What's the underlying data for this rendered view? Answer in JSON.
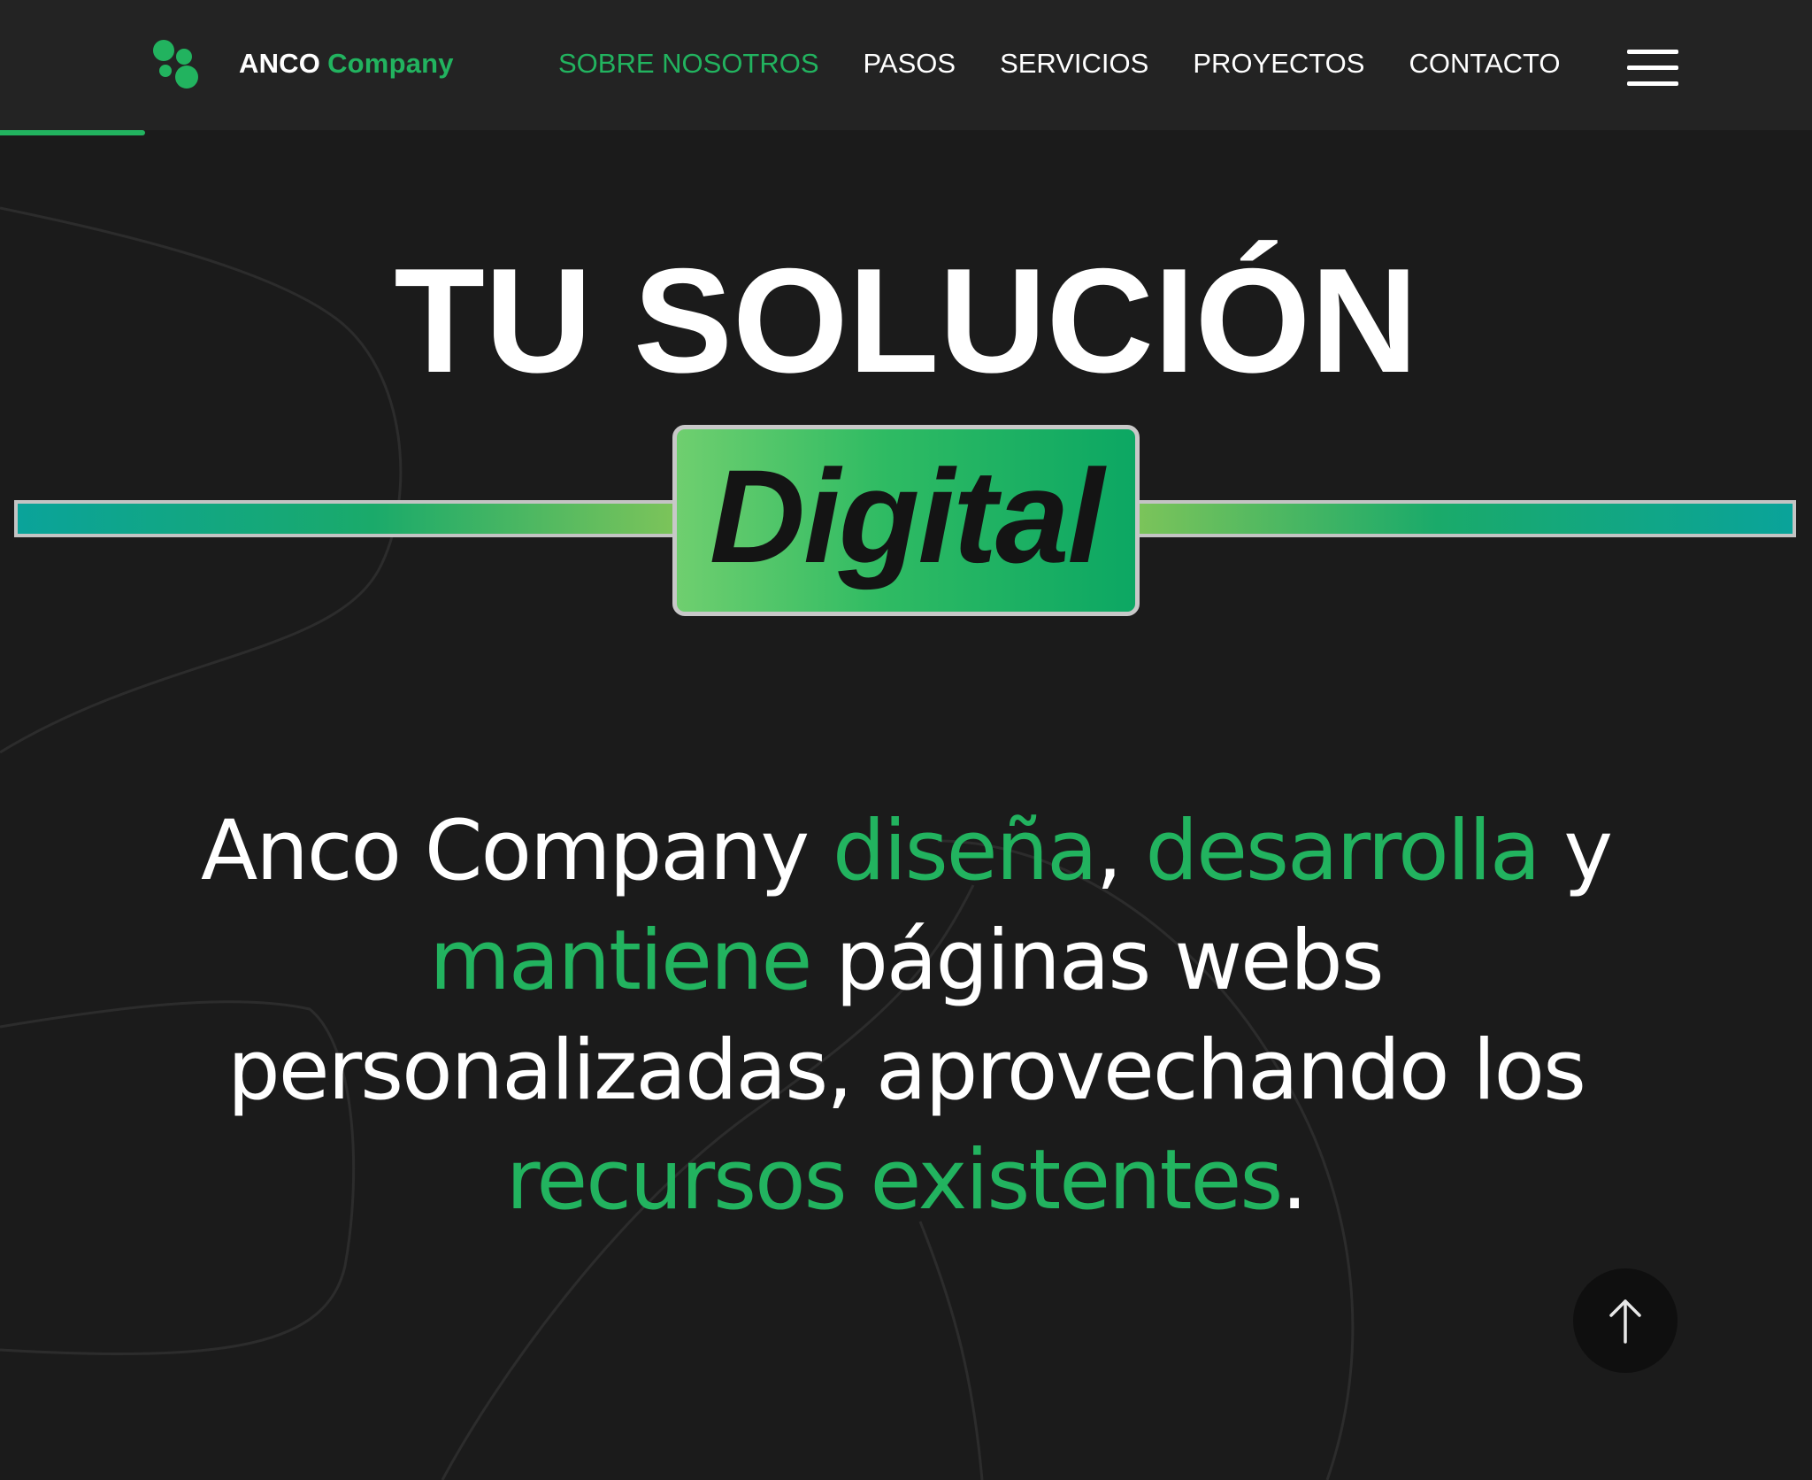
{
  "brand": {
    "name_part1": "ANCO",
    "name_part2": "Company",
    "accent": "#22b35f"
  },
  "nav": {
    "items": [
      {
        "label": "SOBRE NOSOTROS",
        "active": true
      },
      {
        "label": "PASOS",
        "active": false
      },
      {
        "label": "SERVICIOS",
        "active": false
      },
      {
        "label": "PROYECTOS",
        "active": false
      },
      {
        "label": "CONTACTO",
        "active": false
      }
    ],
    "menu_icon": "hamburger-icon"
  },
  "scroll_progress": 0.08,
  "hero": {
    "title": "TU SOLUCIÓN",
    "badge": "Digital"
  },
  "description": {
    "segments": [
      {
        "text": "Anco Company ",
        "highlight": false
      },
      {
        "text": "diseña",
        "highlight": true
      },
      {
        "text": ", ",
        "highlight": false
      },
      {
        "text": "desarrolla",
        "highlight": true
      },
      {
        "text": " y ",
        "highlight": false
      },
      {
        "text": "mantiene",
        "highlight": true
      },
      {
        "text": " páginas webs personalizadas, aprovechando los ",
        "highlight": false
      },
      {
        "text": "recursos existentes",
        "highlight": true
      },
      {
        "text": ".",
        "highlight": false
      }
    ]
  },
  "scroll_top": {
    "icon": "arrow-up-icon"
  },
  "colors": {
    "background": "#1b1b1b",
    "header": "#232323",
    "highlight": "#22b35f"
  }
}
